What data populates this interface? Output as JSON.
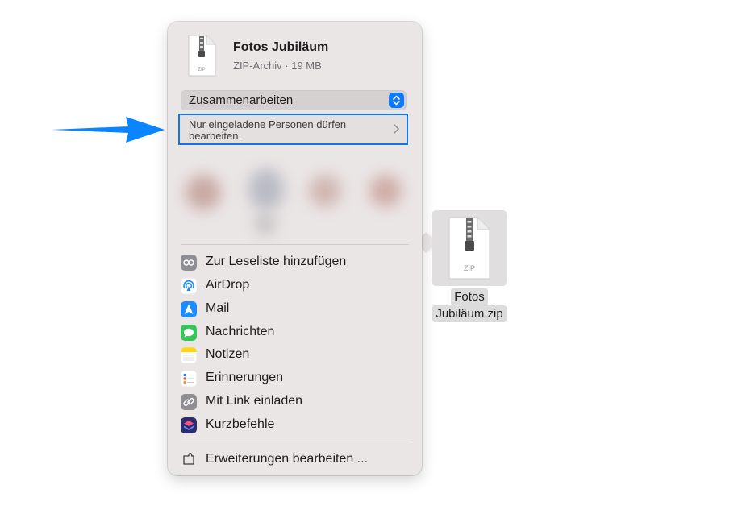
{
  "file": {
    "name": "Fotos Jubiläum",
    "meta": "ZIP-Archiv · 19 MB",
    "icon_label": "ZIP"
  },
  "share_mode": {
    "selected": "Zusammenarbeiten"
  },
  "access": {
    "text": "Nur eingeladene Personen dürfen bearbeiten."
  },
  "menu": {
    "items": [
      {
        "label": "Zur Leseliste hinzufügen",
        "icon": "reading-list-icon",
        "color": "#8e8e93"
      },
      {
        "label": "AirDrop",
        "icon": "airdrop-icon",
        "color": "#ffffff"
      },
      {
        "label": "Mail",
        "icon": "mail-icon",
        "color": "#1b8cff"
      },
      {
        "label": "Nachrichten",
        "icon": "messages-icon",
        "color": "#32c759"
      },
      {
        "label": "Notizen",
        "icon": "notes-icon",
        "color": "#ffd60a"
      },
      {
        "label": "Erinnerungen",
        "icon": "reminders-icon",
        "color": "#ffffff"
      },
      {
        "label": "Mit Link einladen",
        "icon": "link-icon",
        "color": "#8e8e93"
      },
      {
        "label": "Kurzbefehle",
        "icon": "shortcuts-icon",
        "color": "#3b3b8c"
      }
    ],
    "footer": {
      "label": "Erweiterungen bearbeiten ...",
      "icon": "extensions-icon"
    }
  },
  "desktop_file": {
    "caption_line1": "Fotos",
    "caption_line2": "Jubiläum.zip",
    "icon_label": "ZIP"
  },
  "colors": {
    "accent": "#0a7aff",
    "arrow": "#0a84ff",
    "highlight_border": "#1275e3"
  }
}
